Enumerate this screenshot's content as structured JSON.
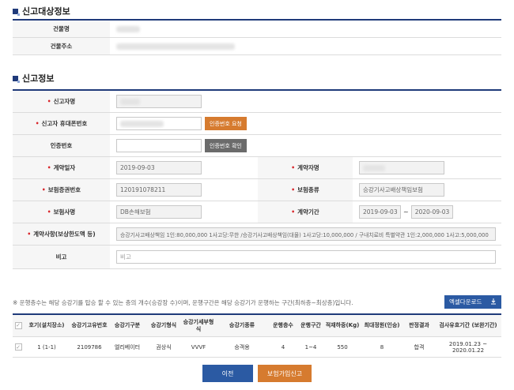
{
  "target_section": {
    "title": "신고대상정보",
    "building_name_label": "건물명",
    "building_address_label": "건물주소"
  },
  "report_section": {
    "title": "신고정보",
    "reporter_name_label": "신고자명",
    "reporter_phone_label": "신고자 휴대폰번호",
    "request_code_button": "인증번호 요청",
    "auth_code_label": "인증번호",
    "verify_code_button": "인증번호 확인",
    "contract_date_label": "계약일자",
    "contract_date_value": "2019-09-03",
    "contractor_label": "계약자명",
    "policy_number_label": "보험증권번호",
    "policy_number_value": "120191078211",
    "insurance_type_label": "보험종류",
    "insurance_type_value": "승강기사고배상책임보험",
    "insurer_label": "보험사명",
    "insurer_value": "DB손해보험",
    "contract_period_label": "계약기간",
    "period_start": "2019-09-03",
    "period_tilde": "~",
    "period_end": "2020-09-03",
    "contract_details_label": "계약사항(보상한도액 등)",
    "contract_details_value": "승강기사고배상책임 1인:80,000,000 1사고당:무한 /승강기사고배상책임(대물) 1사고당:10,000,000 / 구내치료비 특별약관 1인:2,000,000 1사고:5,000,000",
    "remarks_label": "비고",
    "remarks_placeholder": "비고"
  },
  "note": "※ 운행층수는 해당 승강기를 탑승 할 수 있는 층의 개수(승강장 수)이며, 운행구간은 해당 승강기가 운행하는 구간(최하층~최상층)입니다.",
  "excel_button": "엑셀다운로드",
  "excel_icon": "download-icon",
  "table": {
    "headers": [
      "호기(설치장소)",
      "승강기고유번호",
      "승강기구분",
      "승강기형식",
      "승강기세부형식",
      "승강기종류",
      "운행층수",
      "운행구간",
      "적재하중(Kg)",
      "최대정원(인승)",
      "판정결과",
      "검사유효기간 (보완기간)"
    ],
    "rows": [
      [
        "1 (1-1)",
        "2109786",
        "엘리베이터",
        "권상식",
        "VVVF",
        "승객용",
        "4",
        "1~4",
        "550",
        "8",
        "합격",
        "2019.01.23 ~ 2020.01.22"
      ]
    ]
  },
  "prev_button": "이전",
  "submit_button": "보험가입신고",
  "colors": {
    "primary": "#2b5aa3",
    "accent": "#d67b2f",
    "header_line": "#1f3a7a",
    "required": "#d9252a"
  }
}
